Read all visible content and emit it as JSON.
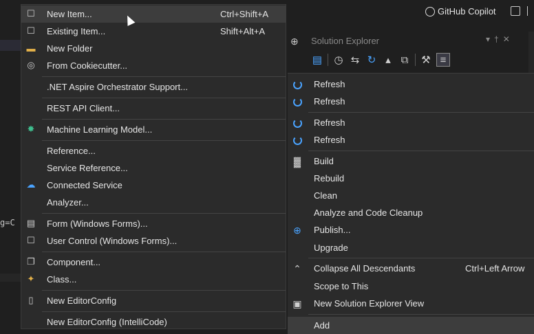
{
  "colors": {
    "accent": "#4aa3ff",
    "menu_bg": "#2b2b2b",
    "highlight": "#3d3d3d",
    "text": "#e6e6e6"
  },
  "background": {
    "code_fragment": "g=C"
  },
  "topbar": {
    "copilot_label": "GitHub Copilot"
  },
  "solution_explorer": {
    "title": "Solution Explorer"
  },
  "add_menu": {
    "items": [
      {
        "label": "New Item...",
        "shortcut": "Ctrl+Shift+A",
        "icon": "new-item-icon"
      },
      {
        "label": "Existing Item...",
        "shortcut": "Shift+Alt+A",
        "icon": "existing-item-icon"
      },
      {
        "label": "New Folder",
        "shortcut": "",
        "icon": "folder-icon"
      },
      {
        "label": "From Cookiecutter...",
        "shortcut": "",
        "icon": "cookiecutter-icon"
      },
      {
        "label": ".NET Aspire Orchestrator Support...",
        "shortcut": "",
        "icon": ""
      },
      {
        "label": "REST API Client...",
        "shortcut": "",
        "icon": ""
      },
      {
        "label": "Machine Learning Model...",
        "shortcut": "",
        "icon": "ml-model-icon"
      },
      {
        "label": "Reference...",
        "shortcut": "",
        "icon": ""
      },
      {
        "label": "Service Reference...",
        "shortcut": "",
        "icon": ""
      },
      {
        "label": "Connected Service",
        "shortcut": "",
        "icon": "connected-service-icon"
      },
      {
        "label": "Analyzer...",
        "shortcut": "",
        "icon": ""
      },
      {
        "label": "Form (Windows Forms)...",
        "shortcut": "",
        "icon": "form-icon"
      },
      {
        "label": "User Control (Windows Forms)...",
        "shortcut": "",
        "icon": "user-control-icon"
      },
      {
        "label": "Component...",
        "shortcut": "",
        "icon": "component-icon"
      },
      {
        "label": "Class...",
        "shortcut": "",
        "icon": "class-icon"
      },
      {
        "label": "New EditorConfig",
        "shortcut": "",
        "icon": "editorconfig-icon"
      },
      {
        "label": "New EditorConfig (IntelliCode)",
        "shortcut": "",
        "icon": ""
      }
    ]
  },
  "context_menu": {
    "items": [
      {
        "label": "Refresh",
        "shortcut": "",
        "icon": "refresh-icon"
      },
      {
        "label": "Refresh",
        "shortcut": "",
        "icon": "refresh-icon"
      },
      {
        "label": "Refresh",
        "shortcut": "",
        "icon": "refresh-icon"
      },
      {
        "label": "Refresh",
        "shortcut": "",
        "icon": "refresh-icon"
      },
      {
        "label": "Build",
        "shortcut": "",
        "icon": "build-icon"
      },
      {
        "label": "Rebuild",
        "shortcut": "",
        "icon": ""
      },
      {
        "label": "Clean",
        "shortcut": "",
        "icon": ""
      },
      {
        "label": "Analyze and Code Cleanup",
        "shortcut": "",
        "icon": ""
      },
      {
        "label": "Publish...",
        "shortcut": "",
        "icon": "publish-icon"
      },
      {
        "label": "Upgrade",
        "shortcut": "",
        "icon": ""
      },
      {
        "label": "Collapse All Descendants",
        "shortcut": "Ctrl+Left Arrow",
        "icon": "chevron-up-icon"
      },
      {
        "label": "Scope to This",
        "shortcut": "",
        "icon": ""
      },
      {
        "label": "New Solution Explorer View",
        "shortcut": "",
        "icon": "new-view-icon"
      },
      {
        "label": "Add",
        "shortcut": "",
        "icon": ""
      }
    ]
  }
}
